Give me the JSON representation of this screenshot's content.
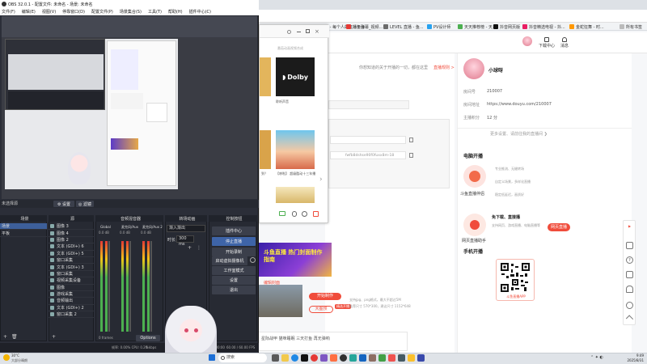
{
  "browser": {
    "bookmarks": [
      "斗鱼 - 每个人的直播平台",
      "斗鱼弹幕_视频...",
      "LEVEL 直播 - 鱼...",
      "PV设计师",
      "天天推荐榜 - 天...",
      "抖音网页版",
      "抖音精选电视 - 抖...",
      "金蛇狂舞 - 时...",
      "所有书签"
    ],
    "header": {
      "upload_label": "下载中心",
      "msg_label": "消息"
    },
    "notice_text": "你想知道的关于开播的一切，都在这里",
    "notice_link": "直播规则 >"
  },
  "profile": {
    "name": "小球呀",
    "room_label": "房间号",
    "room_value": "210007",
    "url_label": "房间地址",
    "url_value": "https://www.douyu.com/210007",
    "level_label": "主播积分",
    "level_value": "12 分",
    "more_link": "更多设置、请前往我的直播间 ❯"
  },
  "sections": {
    "pc_title": "电脑开播",
    "app1_name": "斗鱼直播伴侣",
    "app1_desc1": "专业推流、无缝转场",
    "app1_desc2": "自定义场景，多样化直播",
    "app1_desc3": "稳定低延迟，画质好",
    "app2_name": "网页直播助手",
    "app2_title": "免下载、直接播",
    "app2_desc": "支持网页、游戏直播、电脑直播等",
    "app2_button": "网页直播",
    "mobile_title": "手机开播",
    "qr_caption": "斗鱼直播APP"
  },
  "main": {
    "field1": "fwfb8dshse90f0fuxx8m-18",
    "upload_button": "开始制作",
    "reupload_button": "大图预",
    "badge": "精选开播",
    "banner_text": "斗鱼直播 热门封面制作指南",
    "tags_label": "星际战甲 猫咪睡眠 三天打鱼 再无弹响",
    "pic_hint1": "支持jpg、png格式，最大不超过5M",
    "pic_hint2": "推荐尺寸 570*300，建议尺寸 1152*648"
  },
  "obs": {
    "title": "OBS 32.0.1 - 配置文件: 未命名 - 场景: 未命名",
    "menu": [
      "文件(F)",
      "编辑(E)",
      "视图(V)",
      "停靠窗口(D)",
      "配置文件(P)",
      "场景集合(S)",
      "工具(T)",
      "帮助(H)",
      "插件中心(C)"
    ],
    "below_preview": [
      "⚙ 设置",
      "◎ 滤镜"
    ],
    "scene_prop": "未选择源",
    "scenes_title": "场景",
    "scenes": [
      "场景",
      "平板"
    ],
    "sources_title": "源",
    "sources": [
      "图像 3",
      "图像 4",
      "图像 2",
      "文本 (GDI+) 6",
      "文本 (GDI+) 5",
      "窗口采集",
      "文本 (GDI+) 3",
      "窗口采集",
      "视频采集设备",
      "图像",
      "游戏采集",
      "音频输出",
      "文本 (GDI+) 2",
      "窗口采集 2"
    ],
    "mixer_title": "音频混音器",
    "mixer_channels": [
      "Global",
      "麦克风/Aux",
      "麦克风/Aux 2"
    ],
    "mixer_db": [
      "0.0 dB",
      "0.0 dB",
      "0.0 dB"
    ],
    "transition_title": "转场动画",
    "transition_value": "渐入渐出",
    "duration_label": "时长",
    "duration_value": "300 ms",
    "controls_title": "控制按钮",
    "controls": [
      "插件中心",
      "停止直播",
      "开始录制",
      "启动虚拟摄像机",
      "工作室模式",
      "设置",
      "退出"
    ],
    "footer_left": "0 frames",
    "footer_mid": "帧率: 0.00%   CPU: 0.2%",
    "footer_kbps": "0 kbps",
    "footer_time": "00:00:00",
    "footer_fps": "60.00 / 60.00 FPS",
    "options_label": "Options"
  },
  "darkwin": {
    "title": "番茄动画视频合成",
    "card_brand": "Dolby",
    "card_caption": "聆听声音",
    "card2_caption": "【哆啦】 超级酷动十三年播",
    "card2_sub": "",
    "caption3": "到？"
  },
  "taskbar": {
    "weather_temp": "30°C",
    "weather_desc": "大部分晴朗",
    "search_placeholder": "搜索",
    "time": "9:49",
    "date": "2025/8/31"
  },
  "colors": {
    "accent": "#f04c3b",
    "obs_bg": "#2b2e38"
  }
}
